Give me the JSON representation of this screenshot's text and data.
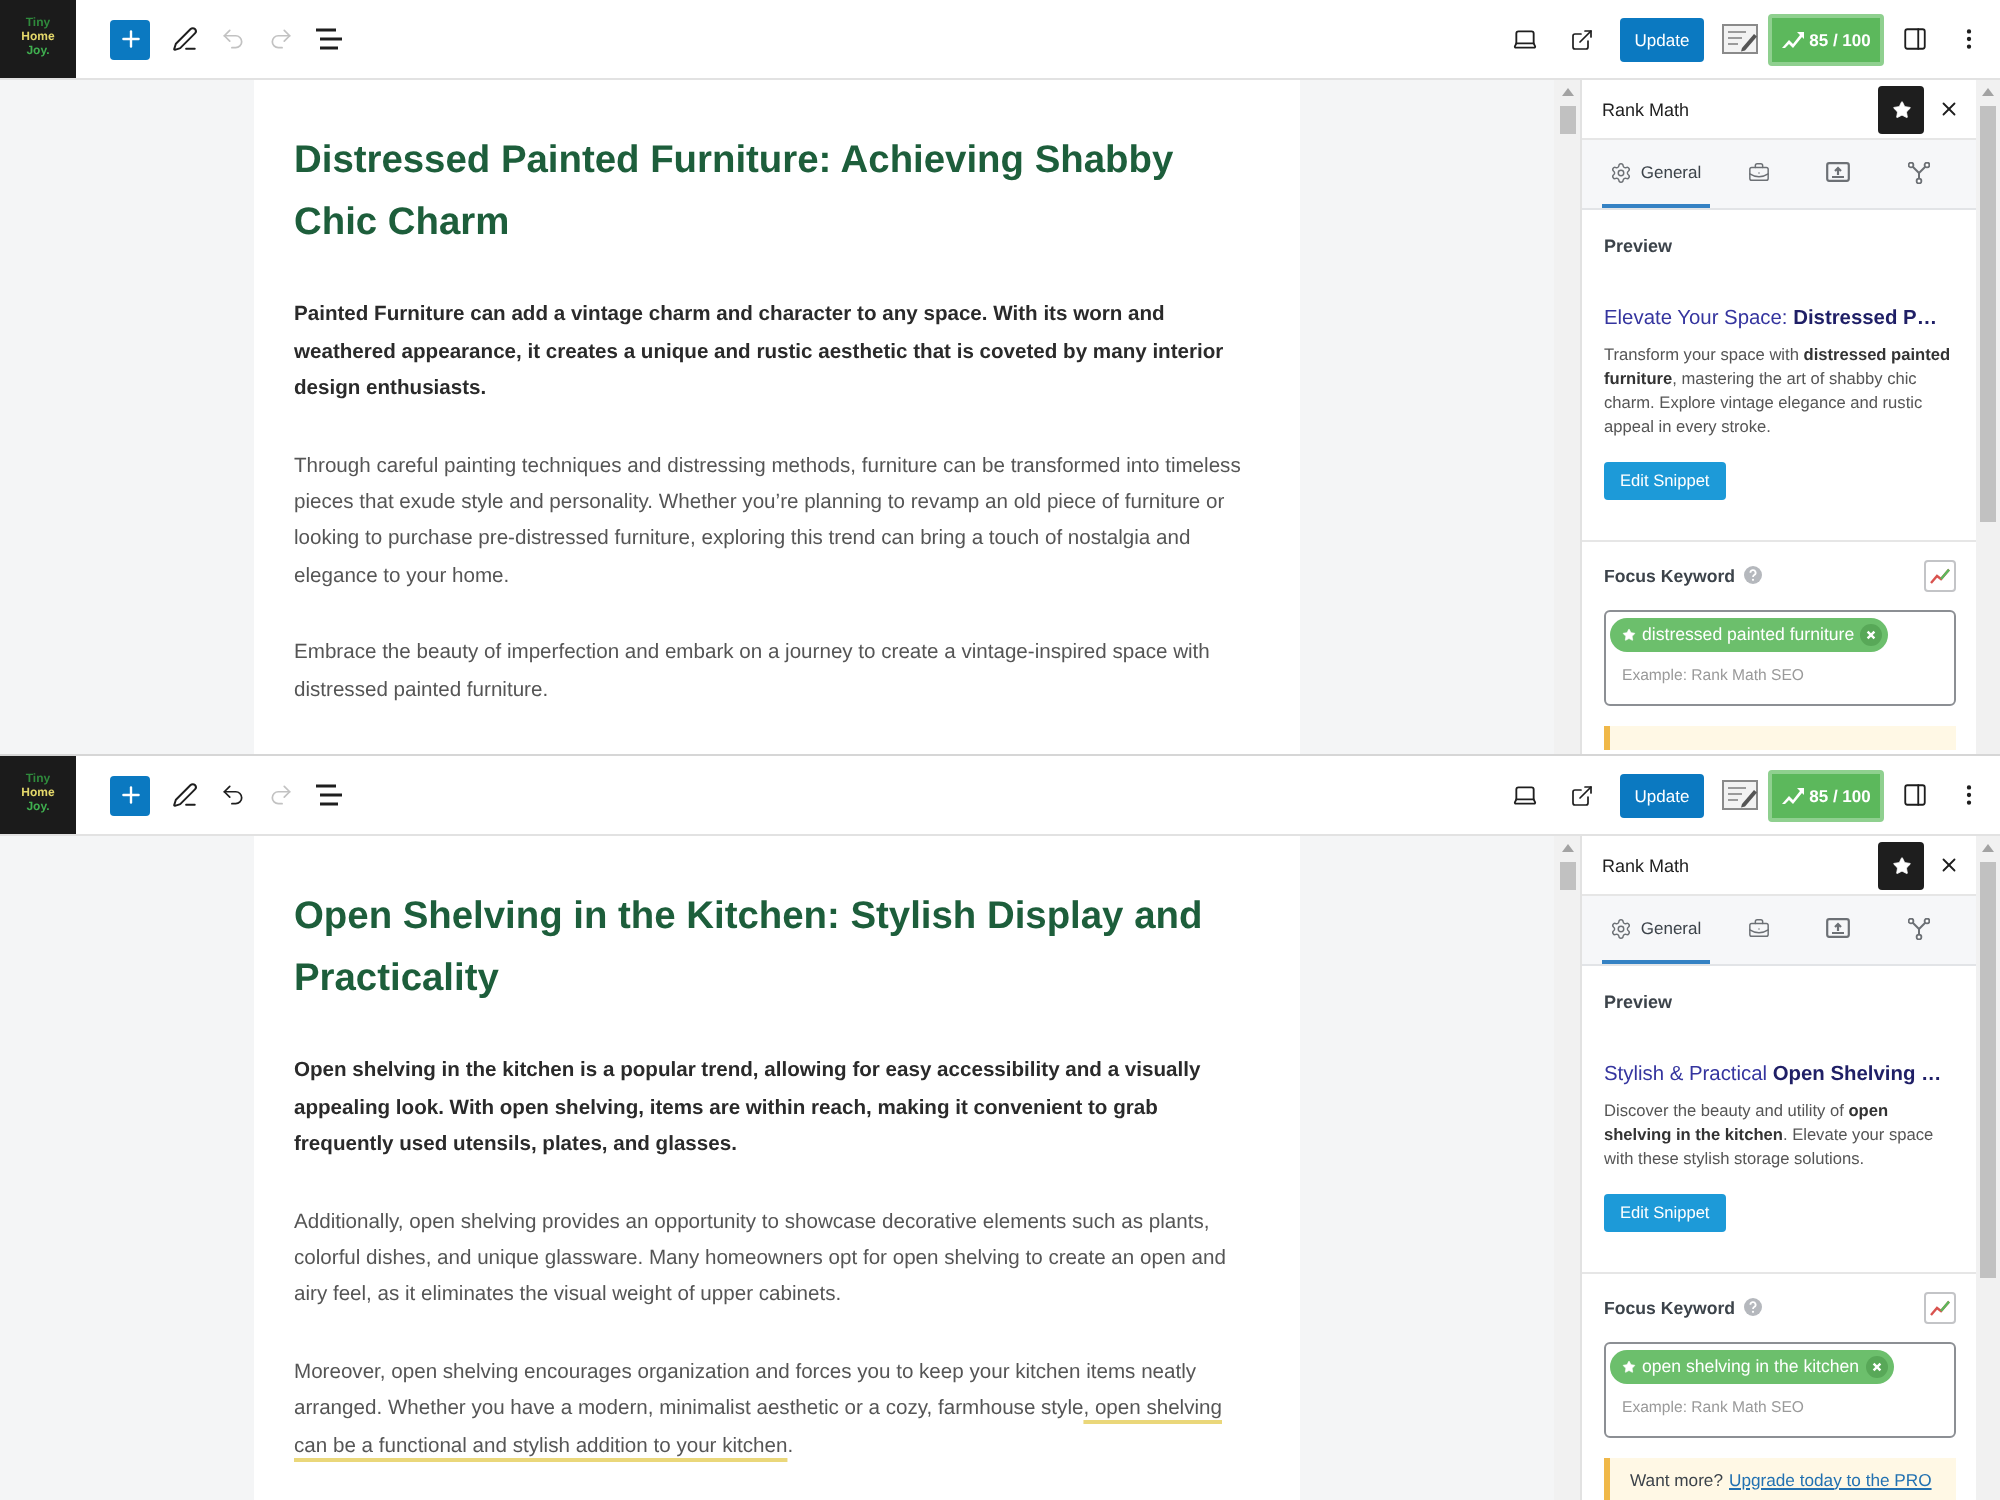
{
  "screens": [
    {
      "toolbar": {
        "logo": [
          "Tiny",
          "Home",
          "Joy."
        ],
        "undo_disabled": true,
        "redo_disabled": true,
        "update_label": "Update",
        "score": "85 / 100"
      },
      "post": {
        "title": "Distressed Painted Furniture: Achieving Shabby Chic Charm",
        "intro": "Painted Furniture can add a vintage charm and character to any space. With its worn and weathered appearance, it creates a unique and rustic aesthetic that is coveted by many interior design enthusiasts.",
        "paragraphs": [
          {
            "segments": [
              {
                "text": "Through careful painting techniques and distressing methods, furniture can be transformed into timeless pieces that exude style and personality. Whether you’re planning to revamp an old piece of furniture or looking to purchase pre-distressed furniture, exploring this trend can bring a touch of nostalgia and elegance to your home.",
                "underlined": false
              }
            ]
          },
          {
            "segments": [
              {
                "text": "Embrace the beauty of imperfection and embark on a journey to create a vintage-inspired space with distressed painted furniture.",
                "underlined": false
              }
            ]
          }
        ]
      },
      "sidebar": {
        "title": "Rank Math",
        "tabs": [
          {
            "kind": "general",
            "label": "General",
            "selected": true
          },
          {
            "kind": "toolbox",
            "selected": false
          },
          {
            "kind": "social",
            "selected": false
          },
          {
            "kind": "schema",
            "selected": false
          }
        ],
        "preview_label": "Preview",
        "snippet_title": "Elevate Your Space: **Distressed P…**",
        "snippet_description": "Transform your space with **distressed painted furniture**, mastering the art of shabby chic charm. Explore vintage elegance and rustic appeal in every stroke.",
        "edit_button": "Edit Snippet",
        "focus_keyword_label": "Focus Keyword",
        "keywords": [
          "distressed painted furniture"
        ],
        "keyword_placeholder": "Example: Rank Math SEO",
        "notice_strip": true
      }
    },
    {
      "toolbar": {
        "logo": [
          "Tiny",
          "Home",
          "Joy."
        ],
        "undo_disabled": false,
        "redo_disabled": true,
        "update_label": "Update",
        "score": "85 / 100"
      },
      "post": {
        "title": "Open Shelving in the Kitchen: Stylish Display and Practicality",
        "intro": "Open shelving in the kitchen is a popular trend, allowing for easy accessibility and a visually appealing look. With open shelving, items are within reach, making it convenient to grab frequently used utensils, plates, and glasses.",
        "paragraphs": [
          {
            "segments": [
              {
                "text": "Additionally, open shelving provides an opportunity to showcase decorative elements such as plants, colorful dishes, and unique glassware. Many homeowners opt for open shelving to create an open and airy feel, as it eliminates the visual weight of upper cabinets.",
                "underlined": false
              }
            ]
          },
          {
            "segments": [
              {
                "text": "Moreover, open shelving encourages organization and forces you to keep your kitchen items neatly arranged. Whether you have a modern, minimalist aesthetic or a cozy, farmhouse style",
                "underlined": false
              },
              {
                "text": ", open shelving can be a functional and stylish addition to your kitchen",
                "underlined": true
              },
              {
                "text": "."
              }
            ]
          }
        ]
      },
      "sidebar": {
        "title": "Rank Math",
        "tabs": [
          {
            "kind": "general",
            "label": "General",
            "selected": true
          },
          {
            "kind": "toolbox",
            "selected": false
          },
          {
            "kind": "social",
            "selected": false
          },
          {
            "kind": "schema",
            "selected": false
          }
        ],
        "preview_label": "Preview",
        "snippet_title": "Stylish & Practical **Open Shelving …**",
        "snippet_description": "Discover the beauty and utility of **open shelving in the kitchen**. Elevate your space with these stylish storage solutions.",
        "edit_button": "Edit Snippet",
        "focus_keyword_label": "Focus Keyword",
        "keywords": [
          "open shelving in the kitchen"
        ],
        "keyword_placeholder": "Example: Rank Math SEO",
        "notice": {
          "text": "Want more?",
          "link": "Upgrade today to the PRO"
        }
      }
    }
  ]
}
